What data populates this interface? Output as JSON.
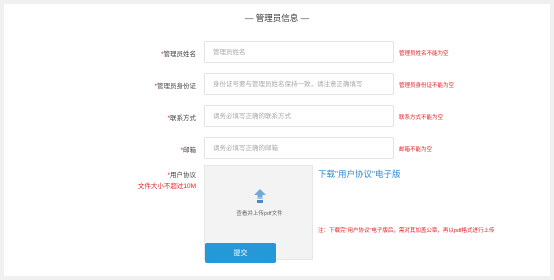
{
  "section": {
    "title": "— 管理员信息 —"
  },
  "fields": {
    "name": {
      "label": "管理员姓名",
      "placeholder": "管理员姓名",
      "value": "",
      "error": "管理员姓名不能为空"
    },
    "id_card": {
      "label": "管理员身份证",
      "placeholder": "身份证号要与管理员姓名保持一致，请注意正确填写",
      "value": "",
      "error": "管理员身份证不能为空"
    },
    "phone": {
      "label": "联系方式",
      "placeholder": "请务必填写正确的联系方式",
      "value": "",
      "error": "联系方式不能为空"
    },
    "email": {
      "label": "邮箱",
      "placeholder": "请务必填写正确的邮箱",
      "value": "",
      "error": "邮箱不能为空"
    }
  },
  "agreement": {
    "label": "用户协议",
    "size_limit": "文件大小不超过10M",
    "upload_text": "查看并上传pdf文件",
    "download_link": "下载\"用户协议\"电子版",
    "note": "注：下载完\"用户协议\"电子版后，需对其加盖公章，再以pdf格式进行上传",
    "upload_icon": "cloud-upload-icon"
  },
  "required_mark": "*",
  "submit_label": "提交",
  "colors": {
    "primary": "#2399d8",
    "link": "#2b8ad6",
    "error": "#e02020"
  }
}
